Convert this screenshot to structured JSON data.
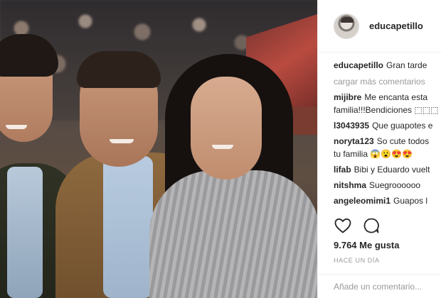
{
  "post": {
    "username": "educapetillo",
    "avatar_icon": "profile-avatar",
    "caption_user": "educapetillo",
    "caption_text": "Gran tarde"
  },
  "comments": {
    "load_more_label": "cargar más comentarios",
    "items": [
      {
        "user": "mijibre",
        "text": "Me encanta esta"
      },
      {
        "user": "",
        "text": "familia!!!Bendiciones ⬚⬚⬚"
      },
      {
        "user": "l3043935",
        "text": "Que guapotes e"
      },
      {
        "user": "noryta123",
        "text": "So cute todos"
      },
      {
        "user": "",
        "text": "tu familia 😱😮😍😍"
      },
      {
        "user": "lifab",
        "text": "Bibi y Eduardo vuelt"
      },
      {
        "user": "nitshma",
        "text": "Suegroooooo"
      },
      {
        "user": "angeleomimi1",
        "text": "Guapos l"
      }
    ]
  },
  "actions": {
    "like_icon": "heart-icon",
    "comment_icon": "comment-icon"
  },
  "likes_label": "9.764 Me gusta",
  "time_ago": "HACE UN DÍA",
  "add_comment": {
    "placeholder": "Añade un comentario..."
  },
  "colors": {
    "text": "#262626",
    "muted": "#999999",
    "divider": "#efefef"
  }
}
